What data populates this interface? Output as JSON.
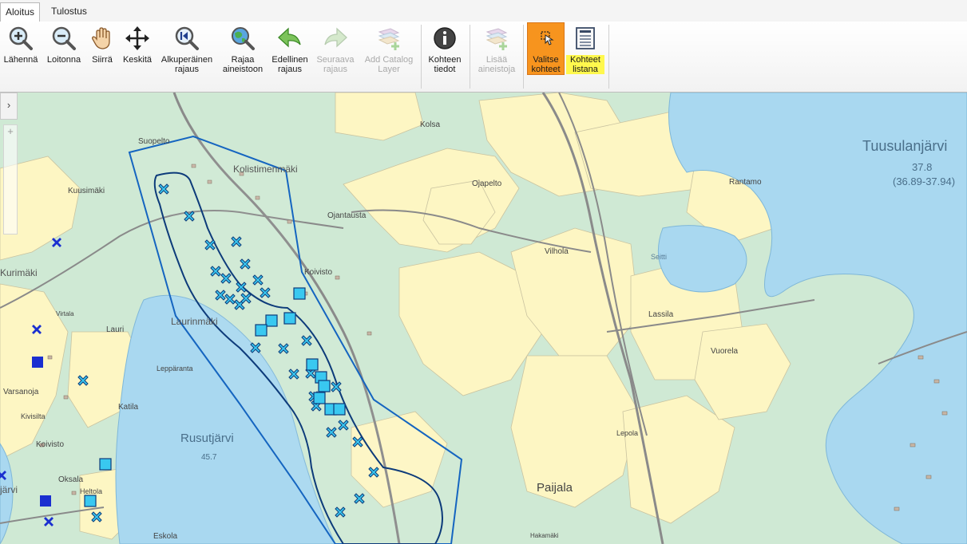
{
  "tabs": [
    {
      "label": "Aloitus"
    },
    {
      "label": "Tulostus"
    }
  ],
  "toolbar": {
    "zoom_in": "Lähennä",
    "zoom_out": "Loitonna",
    "pan": "Siirrä",
    "center": "Keskitä",
    "original_extent": "Alkuperäinen\nrajaus",
    "limit_dataset": "Rajaa\naineistoon",
    "previous_extent": "Edellinen\nrajaus",
    "next_extent": "Seuraava\nrajaus",
    "add_catalog_layer": "Add Catalog\nLayer",
    "feature_info": "Kohteen\ntiedot",
    "add_dataset": "Lisää\naineistoja",
    "select_features": "Valitse\nkohteet",
    "features_list": "Kohteet\nlistana"
  },
  "map": {
    "collapse_glyph": "›",
    "zoom_plus": "+",
    "place_labels": {
      "tuusulanjarvi": "Tuusulanjärvi",
      "tuusula_depth": "37.8",
      "tuusula_range": "(36.89-37.94)",
      "rusutjarvi": "Rusutjärvi",
      "rusut_depth": "45.7",
      "kolistimenmaki": "Kolistimenmäki",
      "kurimaki": "Kurimäki",
      "laurinmaki": "Laurinmäki",
      "paijala": "Paijala",
      "lassila": "Lassila",
      "kolsa": "Kolsa",
      "ojapelto": "Ojapelto",
      "ojantausta": "Ojantausta",
      "koivisto": "Koivisto",
      "koivisto2": "Koivisto",
      "vilhola": "Vilhola",
      "rantamo": "Rantamo",
      "kuusimaki": "Kuusimäki",
      "suopelto": "Suopelto",
      "varsanoja": "Varsanoja",
      "kivisilta": "Kivisilta",
      "katila": "Katila",
      "leppiranta": "Leppäranta",
      "oksala": "Oksala",
      "eskola": "Eskola",
      "heltola": "Heltola",
      "vuorela": "Vuorela",
      "lepola": "Lepola",
      "seitti": "Seitti",
      "hakamaki": "Hakamäki",
      "virtala": "Virtala",
      "lauri": "Lauri",
      "jarvi_edge": "järvi"
    }
  },
  "colors": {
    "water": "#a9d8f0",
    "forest": "#cfe9d4",
    "field": "#fdf6c3",
    "boundary": "#1565c0",
    "inner_boundary": "#0d3b7a",
    "marker_fill": "#39c8f0",
    "marker_dark": "#1a2fd0",
    "active_button": "#f7941e",
    "highlight": "#fff84d"
  }
}
